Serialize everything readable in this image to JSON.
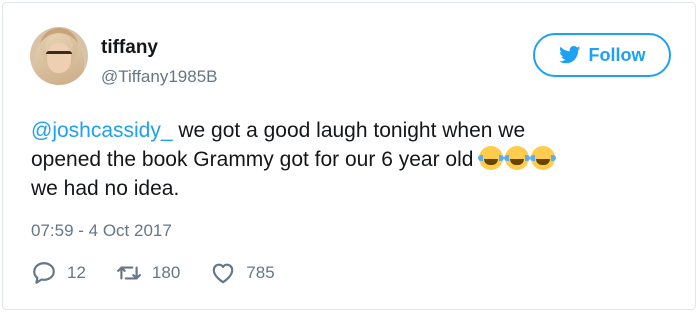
{
  "user": {
    "name": "tiffany",
    "handle": "@Tiffany1985B"
  },
  "follow_button": {
    "label": "Follow",
    "icon": "twitter-bird-icon"
  },
  "tweet": {
    "mention": "@joshcassidy_",
    "text_line1": " we got a good laugh tonight when we",
    "text_line2": "opened the book Grammy got for our 6 year old ",
    "emoji": [
      "face-with-tears-of-joy",
      "face-with-tears-of-joy",
      "face-with-tears-of-joy"
    ],
    "text_line3": "we had no idea.",
    "timestamp": "07:59 - 4 Oct 2017"
  },
  "actions": {
    "replies": "12",
    "retweets": "180",
    "likes": "785"
  },
  "colors": {
    "accent": "#1da1f2",
    "text": "#14171a",
    "muted": "#657786",
    "border": "#e1e8ed"
  }
}
